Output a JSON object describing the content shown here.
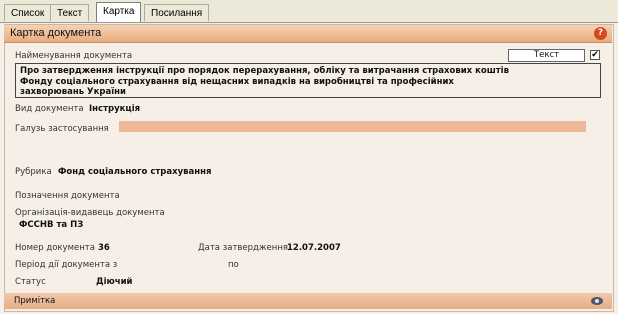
{
  "tabs": [
    {
      "label": "Список"
    },
    {
      "label": "Текст"
    },
    {
      "label": "Картка"
    },
    {
      "label": "Посилання"
    }
  ],
  "header": {
    "title": "Картка документа",
    "help_symbol": "?"
  },
  "document_name": {
    "label": "Найменування документа",
    "lines": [
      "Про затвердження інструкції про порядок перерахування, обліку та витрачання страхових коштів",
      "Фонду соціального страхування від нещасних випадків на виробництві та професійних",
      "захворювань України"
    ]
  },
  "text_document": {
    "label": "Текст документа",
    "checked": true,
    "check_mark": "✔"
  },
  "doc_type": {
    "label": "Вид документа",
    "value": "Інструкція"
  },
  "field_of_application": {
    "label": "Галузь застосування",
    "value": ""
  },
  "rubric": {
    "label": "Рубрика",
    "value": "Фонд соціального страхування"
  },
  "designation": {
    "label": "Позначення документа",
    "value": ""
  },
  "issuer": {
    "label": "Організація-видавець документа",
    "value": "ФССНВ та ПЗ"
  },
  "doc_number": {
    "label": "Номер документа",
    "value": "36"
  },
  "approval_date": {
    "label": "Дата затвердження",
    "value": "12.07.2007"
  },
  "validity": {
    "label": "Період дії документа з",
    "to_label": "по",
    "from": "",
    "to": ""
  },
  "status": {
    "label": "Статус",
    "value": "Діючий"
  },
  "footer": {
    "label": "Примітка"
  },
  "colors": {
    "header": "#e7ac80",
    "panel": "#f6efe7",
    "field_bar": "#efb898",
    "help": "#d24a1e"
  }
}
